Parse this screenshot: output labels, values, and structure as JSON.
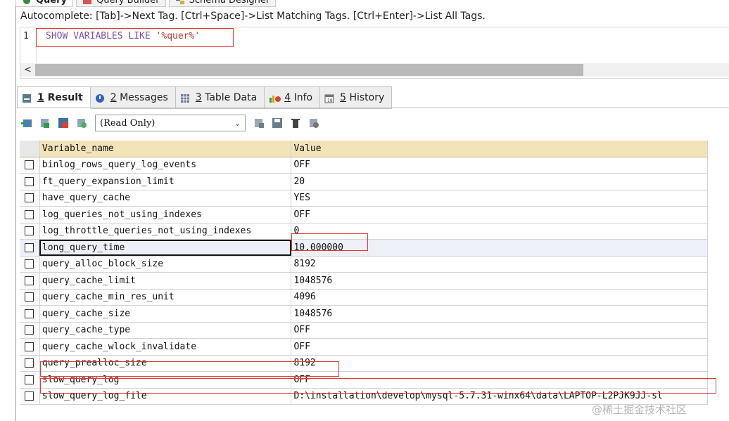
{
  "top_tabs": [
    {
      "label": "Query",
      "icon": "query-icon",
      "active": true
    },
    {
      "label": "Query Builder",
      "icon": "query-builder-icon",
      "active": false
    },
    {
      "label": "Schema Designer",
      "icon": "schema-designer-icon",
      "active": false
    }
  ],
  "autocomplete_hint": "Autocomplete: [Tab]->Next Tag. [Ctrl+Space]->List Matching Tags. [Ctrl+Enter]->List All Tags.",
  "editor": {
    "line_number": "1",
    "sql_keywords": "SHOW VARIABLES LIKE ",
    "sql_string": "'%quer%'"
  },
  "result_tabs": [
    {
      "num": "1",
      "label": "Result",
      "icon": "result-icon",
      "active": true
    },
    {
      "num": "2",
      "label": "Messages",
      "icon": "messages-icon",
      "active": false
    },
    {
      "num": "3",
      "label": "Table Data",
      "icon": "table-data-icon",
      "active": false
    },
    {
      "num": "4",
      "label": "Info",
      "icon": "info-icon",
      "active": false
    },
    {
      "num": "5",
      "label": "History",
      "icon": "history-icon",
      "active": false
    }
  ],
  "toolbar": {
    "mode": "(Read Only)"
  },
  "grid": {
    "columns": [
      "Variable_name",
      "Value"
    ],
    "rows": [
      [
        "binlog_rows_query_log_events",
        "OFF"
      ],
      [
        "ft_query_expansion_limit",
        "20"
      ],
      [
        "have_query_cache",
        "YES"
      ],
      [
        "log_queries_not_using_indexes",
        "OFF"
      ],
      [
        "log_throttle_queries_not_using_indexes",
        "0"
      ],
      [
        "long_query_time",
        "10.000000"
      ],
      [
        "query_alloc_block_size",
        "8192"
      ],
      [
        "query_cache_limit",
        "1048576"
      ],
      [
        "query_cache_min_res_unit",
        "4096"
      ],
      [
        "query_cache_size",
        "1048576"
      ],
      [
        "query_cache_type",
        "OFF"
      ],
      [
        "query_cache_wlock_invalidate",
        "OFF"
      ],
      [
        "query_prealloc_size",
        "8192"
      ],
      [
        "slow_query_log",
        "OFF"
      ],
      [
        "slow_query_log_file",
        "D:\\installation\\develop\\mysql-5.7.31-winx64\\data\\LAPTOP-L2PJK9JJ-sl"
      ]
    ]
  },
  "colors": {
    "highlight": "#e53935",
    "header_bg": "#f2e3b8"
  },
  "watermark": "@稀土掘金技术社区"
}
